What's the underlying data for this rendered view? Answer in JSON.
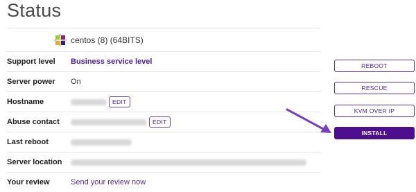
{
  "page": {
    "title": "Status"
  },
  "os": {
    "label": "centos (8) (64BITS)",
    "icon": "centos-logo-icon"
  },
  "rows": [
    {
      "label": "Support level",
      "value": "Business service level"
    },
    {
      "label": "Server power",
      "value": "On"
    },
    {
      "label": "Hostname",
      "edit_label": "EDIT"
    },
    {
      "label": "Abuse contact",
      "edit_label": "EDIT"
    },
    {
      "label": "Last reboot"
    },
    {
      "label": "Server location"
    },
    {
      "label": "Your review",
      "value": "Send your review now"
    }
  ],
  "actions": {
    "reboot": "REBOOT",
    "rescue": "RESCUE",
    "kvm": "KVM OVER IP",
    "install": "INSTALL"
  },
  "colors": {
    "accent": "#4b0f8f",
    "link": "#5a2b9a",
    "arrow": "#7a3fbf"
  }
}
